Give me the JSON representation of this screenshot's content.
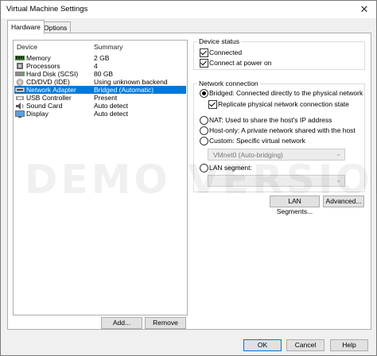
{
  "window": {
    "title": "Virtual Machine Settings",
    "close_glyph": "✕"
  },
  "tabs": [
    {
      "label": "Hardware",
      "active": true
    },
    {
      "label": "Options",
      "active": false
    }
  ],
  "device_list": {
    "columns": {
      "device": "Device",
      "summary": "Summary"
    },
    "rows": [
      {
        "device": "Memory",
        "summary": "2 GB",
        "icon": "memory-icon"
      },
      {
        "device": "Processors",
        "summary": "4",
        "icon": "processor-icon"
      },
      {
        "device": "Hard Disk (SCSI)",
        "summary": "80 GB",
        "icon": "hard-disk-icon"
      },
      {
        "device": "CD/DVD (IDE)",
        "summary": "Using unknown backend",
        "icon": "cd-dvd-icon"
      },
      {
        "device": "Network Adapter",
        "summary": "Bridged (Automatic)",
        "icon": "network-adapter-icon",
        "selected": true
      },
      {
        "device": "USB Controller",
        "summary": "Present",
        "icon": "usb-icon"
      },
      {
        "device": "Sound Card",
        "summary": "Auto detect",
        "icon": "sound-card-icon"
      },
      {
        "device": "Display",
        "summary": "Auto detect",
        "icon": "display-icon"
      }
    ],
    "add_label": "Add...",
    "remove_label": "Remove"
  },
  "device_status": {
    "title": "Device status",
    "connected": {
      "label": "Connected",
      "checked": true
    },
    "connect_at_power_on": {
      "label": "Connect at power on",
      "checked": true
    }
  },
  "network_connection": {
    "title": "Network connection",
    "bridged": {
      "label": "Bridged: Connected directly to the physical network",
      "selected": true
    },
    "replicate": {
      "label": "Replicate physical network connection state",
      "checked": true
    },
    "nat": {
      "label": "NAT: Used to share the host's IP address",
      "selected": false
    },
    "host_only": {
      "label": "Host-only: A private network shared with the host",
      "selected": false
    },
    "custom": {
      "label": "Custom: Specific virtual network",
      "selected": false
    },
    "custom_value": "VMnet0 (Auto-bridging)",
    "lan_segment": {
      "label": "LAN segment:",
      "selected": false
    },
    "lan_value": ""
  },
  "buttons": {
    "lan_segments": "LAN Segments...",
    "advanced": "Advanced...",
    "ok": "OK",
    "cancel": "Cancel",
    "help": "Help"
  },
  "watermark": "DEMO VERSION",
  "colors": {
    "selection": "#0078d7",
    "window_bg": "#f0f0f0"
  }
}
